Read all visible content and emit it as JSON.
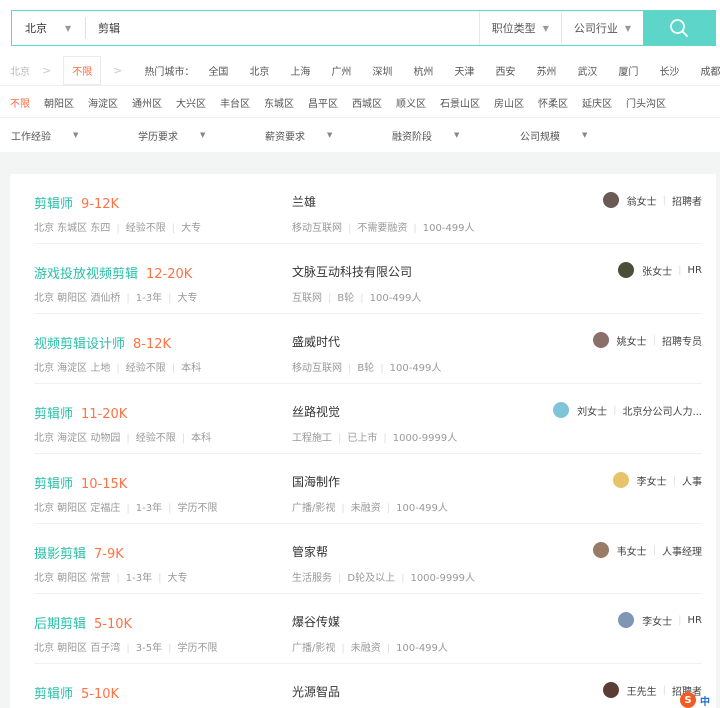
{
  "search": {
    "city": "北京",
    "keyword": "剪辑",
    "job_type_label": "职位类型",
    "industry_label": "公司行业"
  },
  "breadcrumb": {
    "current_city": "北京",
    "unlimited": "不限"
  },
  "hot_cities": {
    "label": "热门城市：",
    "items": [
      "全国",
      "北京",
      "上海",
      "广州",
      "深圳",
      "杭州",
      "天津",
      "西安",
      "苏州",
      "武汉",
      "厦门",
      "长沙",
      "成都"
    ]
  },
  "districts": {
    "selected": "不限",
    "items": [
      "朝阳区",
      "海淀区",
      "通州区",
      "大兴区",
      "丰台区",
      "东城区",
      "昌平区",
      "西城区",
      "顺义区",
      "石景山区",
      "房山区",
      "怀柔区",
      "延庆区",
      "门头沟区"
    ]
  },
  "filters": [
    "工作经验",
    "学历要求",
    "薪资要求",
    "融资阶段",
    "公司规模"
  ],
  "jobs": [
    {
      "title": "剪辑师",
      "salary": "9-12K",
      "location": "北京 东城区 东四",
      "exp": "经验不限",
      "edu": "大专",
      "company": "兰雄",
      "industry": "移动互联网",
      "funding": "不需要融资",
      "size": "100-499人",
      "recruiter": "翁女士",
      "role": "招聘者",
      "avatar_color": "#6a5a55"
    },
    {
      "title": "游戏投放视频剪辑",
      "salary": "12-20K",
      "location": "北京 朝阳区 酒仙桥",
      "exp": "1-3年",
      "edu": "大专",
      "company": "文脉互动科技有限公司",
      "industry": "互联网",
      "funding": "B轮",
      "size": "100-499人",
      "recruiter": "张女士",
      "role": "HR",
      "avatar_color": "#4b4f3a"
    },
    {
      "title": "视频剪辑设计师",
      "salary": "8-12K",
      "location": "北京 海淀区 上地",
      "exp": "经验不限",
      "edu": "本科",
      "company": "盛威时代",
      "industry": "移动互联网",
      "funding": "B轮",
      "size": "100-499人",
      "recruiter": "姚女士",
      "role": "招聘专员",
      "avatar_color": "#8a7068"
    },
    {
      "title": "剪辑师",
      "salary": "11-20K",
      "location": "北京 海淀区 动物园",
      "exp": "经验不限",
      "edu": "本科",
      "company": "丝路视觉",
      "industry": "工程施工",
      "funding": "已上市",
      "size": "1000-9999人",
      "recruiter": "刘女士",
      "role": "北京分公司人力...",
      "avatar_color": "#7fc4d8"
    },
    {
      "title": "剪辑师",
      "salary": "10-15K",
      "location": "北京 朝阳区 定福庄",
      "exp": "1-3年",
      "edu": "学历不限",
      "company": "国海制作",
      "industry": "广播/影视",
      "funding": "未融资",
      "size": "100-499人",
      "recruiter": "李女士",
      "role": "人事",
      "avatar_color": "#e7c46a"
    },
    {
      "title": "摄影剪辑",
      "salary": "7-9K",
      "location": "北京 朝阳区 常营",
      "exp": "1-3年",
      "edu": "大专",
      "company": "管家帮",
      "industry": "生活服务",
      "funding": "D轮及以上",
      "size": "1000-9999人",
      "recruiter": "韦女士",
      "role": "人事经理",
      "avatar_color": "#9a7c66"
    },
    {
      "title": "后期剪辑",
      "salary": "5-10K",
      "location": "北京 朝阳区 百子湾",
      "exp": "3-5年",
      "edu": "学历不限",
      "company": "爆谷传媒",
      "industry": "广播/影视",
      "funding": "未融资",
      "size": "100-499人",
      "recruiter": "李女士",
      "role": "HR",
      "avatar_color": "#7f97b5"
    },
    {
      "title": "剪辑师",
      "salary": "5-10K",
      "location": "",
      "exp": "",
      "edu": "",
      "company": "光源智品",
      "industry": "",
      "funding": "",
      "size": "",
      "recruiter": "王先生",
      "role": "招聘者",
      "avatar_color": "#5a3e36"
    }
  ],
  "ime": {
    "logo": "S",
    "lang": "中"
  }
}
